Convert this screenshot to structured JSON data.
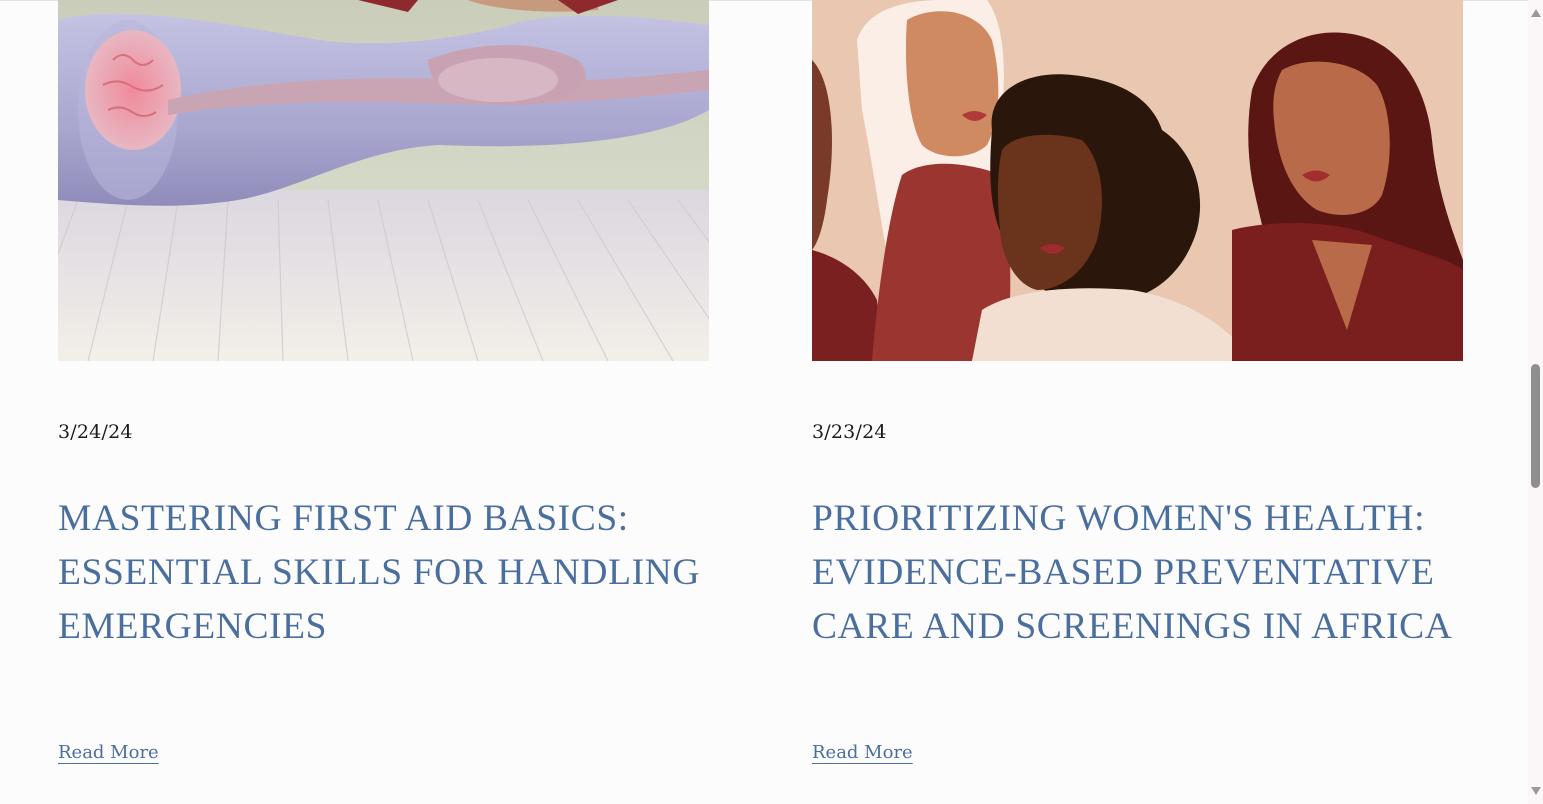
{
  "posts": [
    {
      "image_alt": "first-aid-cpr-illustration",
      "date": "3/24/24",
      "title": "Mastering First Aid Basics: Essential Skills for Handling Emergencies",
      "read_more": "Read More"
    },
    {
      "image_alt": "womens-health-illustration",
      "date": "3/23/24",
      "title": "Prioritizing Women's Health: Evidence-Based Preventative Care and Screenings in Africa",
      "read_more": "Read More"
    }
  ],
  "colors": {
    "accent": "#4a6e9e",
    "text": "#1b1b1b",
    "background": "#fdfcfc"
  },
  "icons": {
    "scroll_up": "triangle-up-icon",
    "scroll_down": "triangle-down-icon"
  }
}
